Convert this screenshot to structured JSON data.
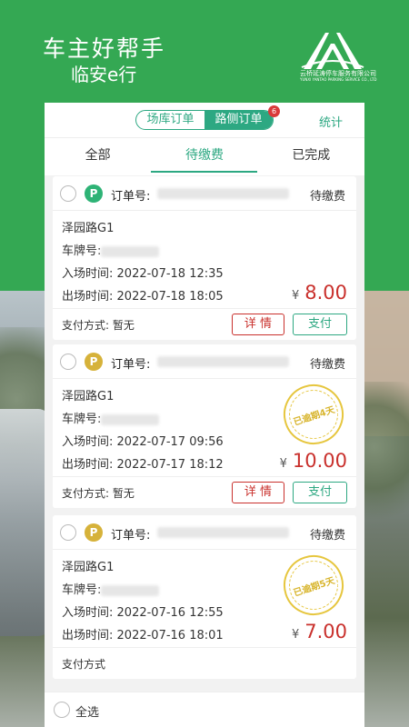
{
  "header": {
    "title": "车主好帮手",
    "subtitle": "临安e行",
    "logo_text_cn": "云桥延涛停车服务有限公司",
    "logo_text_en": "YUNXI YANTAO PARKING SERVICE CO., LTD"
  },
  "segment": {
    "items": [
      {
        "label": "场库订单",
        "active": false
      },
      {
        "label": "路侧订单",
        "active": true
      }
    ],
    "badge": "6",
    "stats_label": "统计"
  },
  "tabs": {
    "items": [
      {
        "label": "全部",
        "active": false
      },
      {
        "label": "待缴费",
        "active": true
      },
      {
        "label": "已完成",
        "active": false
      }
    ]
  },
  "orders": [
    {
      "p_letter": "P",
      "order_label": "订单号:",
      "status": "待缴费",
      "location": "泽园路G1",
      "plate_label": "车牌号:",
      "entry_label": "入场时间:",
      "entry_time": "2022-07-18 12:35",
      "exit_label": "出场时间:",
      "exit_time": "2022-07-18 18:05",
      "currency": "¥",
      "amount": "8.00",
      "payment_label": "支付方式:",
      "payment_value": "暂无",
      "detail_button": "详 情",
      "pay_button": "支付"
    },
    {
      "p_letter": "P",
      "order_label": "订单号:",
      "status": "待缴费",
      "location": "泽园路G1",
      "plate_label": "车牌号:",
      "entry_label": "入场时间:",
      "entry_time": "2022-07-17 09:56",
      "exit_label": "出场时间:",
      "exit_time": "2022-07-17 18:12",
      "currency": "¥",
      "amount": "10.00",
      "stamp": "已逾期4天",
      "payment_label": "支付方式:",
      "payment_value": "暂无",
      "detail_button": "详 情",
      "pay_button": "支付"
    },
    {
      "p_letter": "P",
      "order_label": "订单号:",
      "status": "待缴费",
      "location": "泽园路G1",
      "plate_label": "车牌号:",
      "entry_label": "入场时间:",
      "entry_time": "2022-07-16 12:55",
      "exit_label": "出场时间:",
      "exit_time": "2022-07-16 18:01",
      "currency": "¥",
      "amount": "7.00",
      "stamp": "已逾期5天",
      "payment_label": "支付方式"
    }
  ],
  "bottom": {
    "select_all": "全选"
  },
  "colors": {
    "brand_green": "#34a853",
    "accent_teal": "#2da882",
    "amount_red": "#c9302c",
    "stamp_yellow": "#e6c63e"
  }
}
